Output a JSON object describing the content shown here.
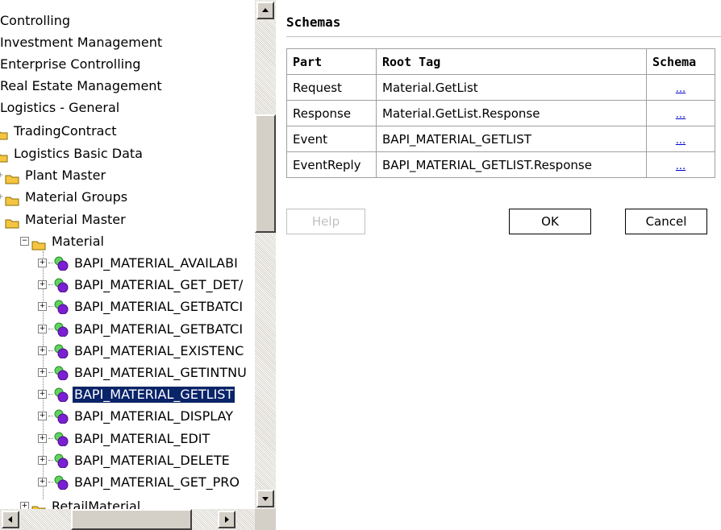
{
  "tree": {
    "items": [
      {
        "label": "Controlling"
      },
      {
        "label": "Investment Management"
      },
      {
        "label": "Enterprise Controlling"
      },
      {
        "label": "Real Estate Management"
      },
      {
        "label": "Logistics - General"
      },
      {
        "label": "TradingContract"
      },
      {
        "label": "Logistics Basic Data"
      },
      {
        "label": "Plant Master"
      },
      {
        "label": "Material Groups"
      },
      {
        "label": "Material Master"
      },
      {
        "label": "Material"
      },
      {
        "label": "BAPI_MATERIAL_AVAILABI"
      },
      {
        "label": "BAPI_MATERIAL_GET_DET/"
      },
      {
        "label": "BAPI_MATERIAL_GETBATCI"
      },
      {
        "label": "BAPI_MATERIAL_GETBATCI"
      },
      {
        "label": "BAPI_MATERIAL_EXISTENC"
      },
      {
        "label": "BAPI_MATERIAL_GETINTNU"
      },
      {
        "label": "BAPI_MATERIAL_GETLIST"
      },
      {
        "label": "BAPI_MATERIAL_DISPLAY"
      },
      {
        "label": "BAPI_MATERIAL_EDIT"
      },
      {
        "label": "BAPI_MATERIAL_DELETE"
      },
      {
        "label": "BAPI_MATERIAL_GET_PRO"
      },
      {
        "label": "RetailMaterial"
      }
    ],
    "selected_label": "BAPI_MATERIAL_GETLIST"
  },
  "schemas": {
    "title": "Schemas",
    "headers": {
      "part": "Part",
      "root_tag": "Root Tag",
      "schema": "Schema"
    },
    "rows": [
      {
        "part": "Request",
        "root_tag": "Material.GetList",
        "schema": "..."
      },
      {
        "part": "Response",
        "root_tag": "Material.GetList.Response",
        "schema": "..."
      },
      {
        "part": "Event",
        "root_tag": "BAPI_MATERIAL_GETLIST",
        "schema": "..."
      },
      {
        "part": "EventReply",
        "root_tag": "BAPI_MATERIAL_GETLIST.Response",
        "schema": "..."
      }
    ]
  },
  "buttons": {
    "help": "Help",
    "ok": "OK",
    "cancel": "Cancel"
  },
  "colors": {
    "selection": "#0a246a",
    "folder": "#f5c542",
    "link": "#0000cc"
  },
  "icons": {
    "folder": "folder-icon",
    "bapi": "bapi-method-icon",
    "expand": "plus-box-icon",
    "collapse": "minus-box-icon"
  }
}
